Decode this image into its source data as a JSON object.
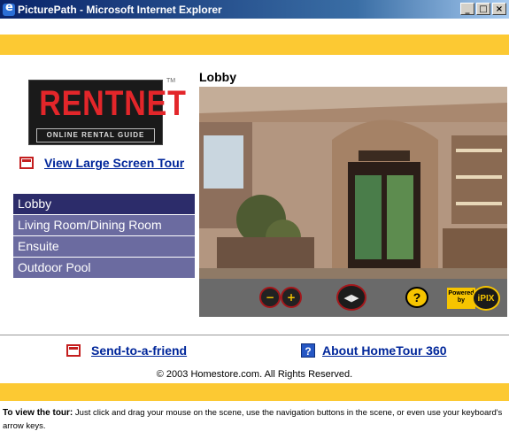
{
  "window": {
    "title": "PicturePath - Microsoft Internet Explorer",
    "buttons": {
      "minimize": "_",
      "maximize": "□",
      "close": "×"
    }
  },
  "logo": {
    "brand": "RENTNET",
    "tagline": "ONLINE RENTAL GUIDE",
    "tm": "TM"
  },
  "large_tour_link": "View Large Screen Tour",
  "scenes": [
    {
      "label": "Lobby",
      "active": true
    },
    {
      "label": "Living Room/Dining Room",
      "active": false
    },
    {
      "label": "Ensuite",
      "active": false
    },
    {
      "label": "Outdoor Pool",
      "active": false
    }
  ],
  "viewer": {
    "scene_title": "Lobby",
    "controls": {
      "zoom_out": "−",
      "zoom_in": "+",
      "navigate": "◀▶",
      "help": "?",
      "powered_by": "Powered by",
      "ipix": "iPIX"
    }
  },
  "footer": {
    "send_link": "Send-to-a-friend",
    "about_link": "About HomeTour 360",
    "about_icon": "?",
    "copyright": "© 2003 Homestore.com. All Rights Reserved."
  },
  "instructions": {
    "lead": "To view the tour:",
    "body": " Just click and drag your mouse on the scene, use the navigation buttons in the scene, or even use your keyboard's arrow keys."
  },
  "colors": {
    "accent_yellow": "#fcc933",
    "scene_active": "#2c2c6a",
    "scene_inactive": "#6b6ba0",
    "link": "#00269a",
    "logo_red": "#e3262a"
  }
}
